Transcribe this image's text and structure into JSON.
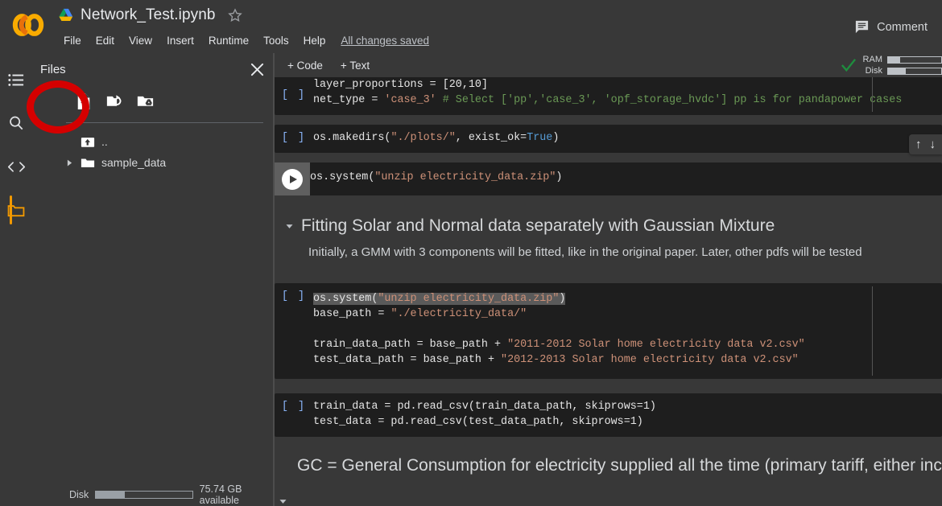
{
  "header": {
    "logo_icon": "colab-logo-icon",
    "drive_icon": "google-drive-icon",
    "notebook_title": "Network_Test.ipynb",
    "star_icon": "star-outline-icon",
    "menus": [
      "File",
      "Edit",
      "View",
      "Insert",
      "Runtime",
      "Tools",
      "Help"
    ],
    "save_status": "All changes saved",
    "comment_icon": "comment-icon",
    "comment_label": "Comment"
  },
  "rail": {
    "items": [
      {
        "name": "table-of-contents",
        "icon": "list-icon",
        "active": false
      },
      {
        "name": "find-and-replace",
        "icon": "search-icon",
        "active": false
      },
      {
        "name": "code-snippets",
        "icon": "code-brackets-icon",
        "active": false
      },
      {
        "name": "files",
        "icon": "folder-icon",
        "active": true
      }
    ],
    "active_color": "#f29900"
  },
  "files_panel": {
    "title": "Files",
    "close_icon": "close-icon",
    "tools": [
      {
        "name": "upload-to-session-storage",
        "icon": "upload-file-icon"
      },
      {
        "name": "refresh-folder",
        "icon": "folder-refresh-icon"
      },
      {
        "name": "mount-drive",
        "icon": "mount-drive-icon"
      }
    ],
    "tree": [
      {
        "label": "..",
        "icon": "parent-folder-icon",
        "has_caret": false
      },
      {
        "label": "sample_data",
        "icon": "folder-icon",
        "has_caret": true
      }
    ],
    "disk_label": "Disk",
    "disk_available": "75.74 GB available",
    "disk_used_pct": 30
  },
  "annotation": {
    "type": "red-ellipse-highlight",
    "color": "#d50000",
    "target": "upload-to-session-storage"
  },
  "notebook_toolbar": {
    "add_code": "+ Code",
    "add_text": "+ Text",
    "connected_icon": "check-icon",
    "connected_color": "#1e8e3e",
    "ram_label": "RAM",
    "ram_pct": 22,
    "disk_label": "Disk",
    "disk_pct": 34
  },
  "move_tools": {
    "move_up_icon": "arrow-up-icon",
    "move_down_icon": "arrow-down-icon"
  },
  "cells": [
    {
      "id": "cell-clipped-top",
      "type": "code",
      "prompt": "[ ]",
      "state": "idle",
      "clipped_top": true,
      "lines": [
        {
          "text": "layer_proportions = [20,10]"
        },
        {
          "text": "net_type = 'case_3' # Select ['pp','case_3', 'opf_storage_hvdc'] pp is for pandapower cases"
        }
      ]
    },
    {
      "id": "cell-makedirs",
      "type": "code",
      "prompt": "[ ]",
      "state": "idle",
      "lines": [
        {
          "text": "os.makedirs(\"./plots/\", exist_ok=True)"
        }
      ]
    },
    {
      "id": "cell-unzip-run",
      "type": "code",
      "prompt": "run",
      "state": "hover-run",
      "lines": [
        {
          "text": "os.system(\"unzip electricity_data.zip\")"
        }
      ]
    },
    {
      "id": "cell-heading",
      "type": "markdown-heading",
      "caret": "▾",
      "text": "Fitting Solar and Normal data separately with Gaussian Mixture"
    },
    {
      "id": "cell-paragraph",
      "type": "markdown-paragraph",
      "text": "Initially, a GMM with 3 components will be fitted, like in the original paper. Later, other pdfs will be tested"
    },
    {
      "id": "cell-paths",
      "type": "code",
      "prompt": "[ ]",
      "state": "selected",
      "lines": [
        {
          "text": "os.system(\"unzip electricity_data.zip\")",
          "selected": true
        },
        {
          "text": "base_path = \"./electricity_data/\""
        },
        {
          "text": ""
        },
        {
          "text": "train_data_path = base_path + \"2011-2012 Solar home electricity data v2.csv\""
        },
        {
          "text": "test_data_path = base_path + \"2012-2013 Solar home electricity data v2.csv\""
        }
      ]
    },
    {
      "id": "cell-read-csv",
      "type": "code",
      "prompt": "[ ]",
      "state": "idle",
      "lines": [
        {
          "text": "train_data = pd.read_csv(train_data_path, skiprows=1)"
        },
        {
          "text": "test_data = pd.read_csv(test_data_path, skiprows=1)"
        }
      ]
    },
    {
      "id": "cell-gc-text",
      "type": "markdown-paragraph-large",
      "text": "GC = General Consumption for electricity supplied all the time (primary tariff, either inclining"
    }
  ],
  "code_text": {
    "line_layer_proportions": "layer_proportions = [20,10]",
    "line_net_type_pre": "net_type = ",
    "line_net_type_val": "'case_3'",
    "line_net_type_comment": " # Select ['pp','case_3', 'opf_storage_hvdc'] pp is for pandapower cases",
    "makedirs_a": "os.makedirs(",
    "makedirs_str": "\"./plots/\"",
    "makedirs_b": ", exist_ok=",
    "makedirs_true": "True",
    "makedirs_c": ")",
    "unzip_a": "os.system(",
    "unzip_str": "\"unzip electricity_data.zip\"",
    "unzip_b": ")",
    "base_a": "base_path = ",
    "base_str": "\"./electricity_data/\"",
    "train_a": "train_data_path = base_path + ",
    "train_str": "\"2011-2012 Solar home electricity data v2.csv\"",
    "test_a": "test_data_path = base_path + ",
    "test_str": "\"2012-2013 Solar home electricity data v2.csv\"",
    "read1": "train_data = pd.read_csv(train_data_path, skiprows=1)",
    "read2": "test_data = pd.read_csv(test_data_path, skiprows=1)"
  }
}
